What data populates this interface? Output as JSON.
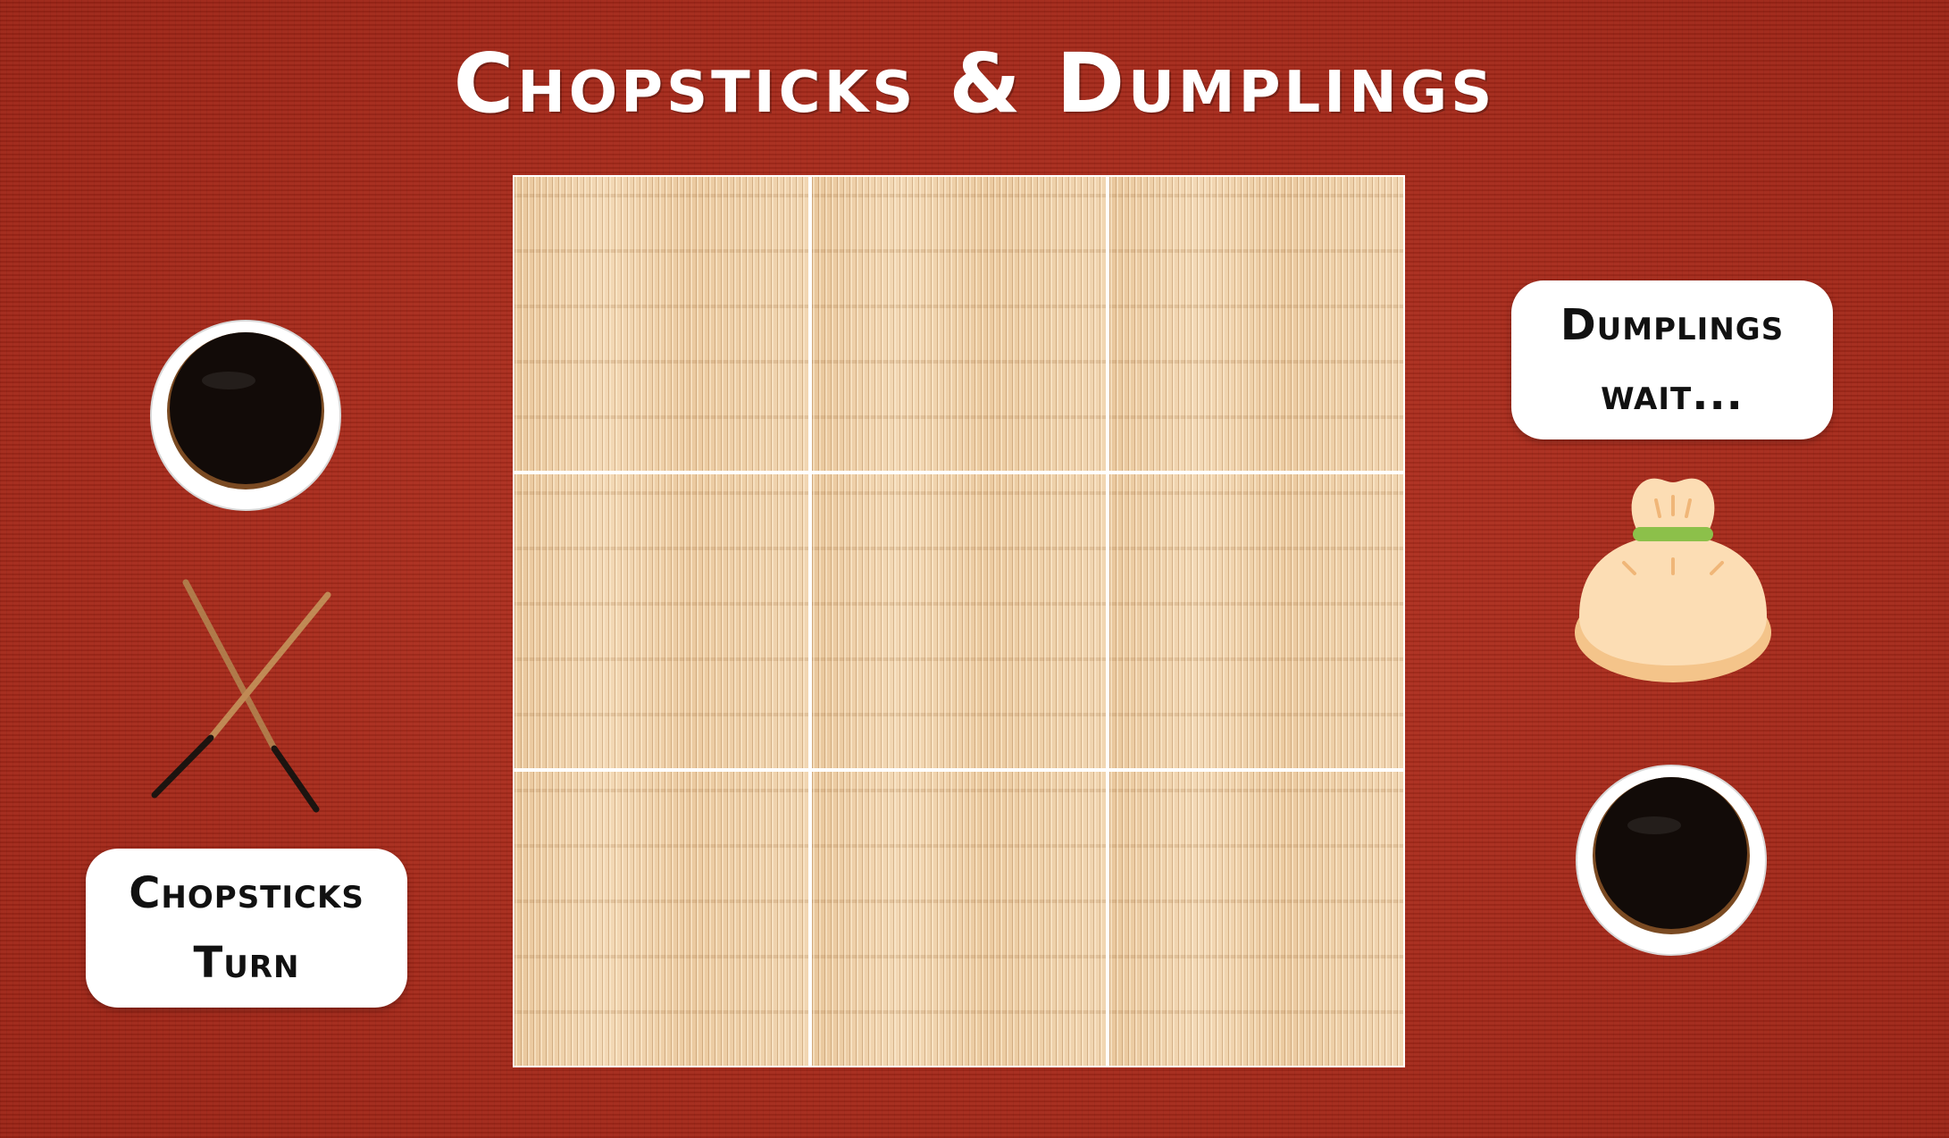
{
  "title": "Chopsticks & Dumplings",
  "players": {
    "chopsticks": {
      "status_line1": "Chopsticks",
      "status_line2": "Turn",
      "icon": "chopsticks-icon"
    },
    "dumplings": {
      "status_line1": "Dumplings",
      "status_line2": "wait...",
      "icon": "dumpling-icon"
    }
  },
  "board": {
    "cells": [
      "",
      "",
      "",
      "",
      "",
      "",
      "",
      "",
      ""
    ]
  },
  "colors": {
    "table_red": "#a8281b",
    "mat_bamboo": "#edcda4",
    "bubble_white": "#ffffff",
    "soy_sauce": "#140d0a"
  }
}
